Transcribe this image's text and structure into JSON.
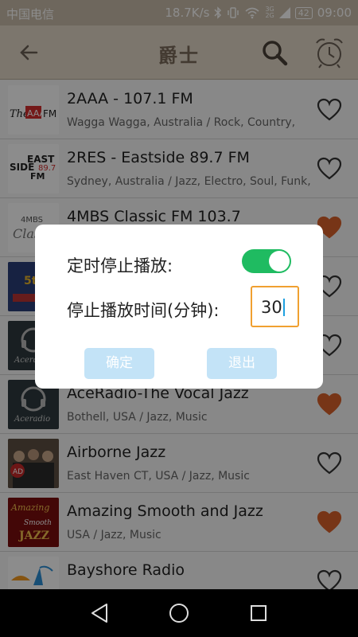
{
  "status_bar": {
    "carrier": "中国电信",
    "speed": "18.7K/s",
    "battery": "42",
    "time": "09:00",
    "net_top": "3G",
    "net_bottom": "2G"
  },
  "header": {
    "title": "爵士"
  },
  "stations": [
    {
      "name": "2AAA - 107.1 FM",
      "desc": "Wagga Wagga, Australia / Rock, Country,",
      "favorite": false,
      "logo_text": "FM"
    },
    {
      "name": "2RES - Eastside 89.7 FM",
      "desc": "Sydney, Australia / Jazz, Electro, Soul, Funk,",
      "favorite": false,
      "logo_text": "EAST SIDE 89.7 FM"
    },
    {
      "name": "4MBS Classic FM 103.7",
      "desc": "",
      "favorite": true,
      "logo_text": "4MBS"
    },
    {
      "name": "",
      "desc": "",
      "favorite": false,
      "logo_text": "5th"
    },
    {
      "name": "",
      "desc": "",
      "favorite": false,
      "logo_text": "Aceradio"
    },
    {
      "name": "AceRadio-The Vocal Jazz",
      "desc": "Bothell, USA / Jazz, Music",
      "favorite": true,
      "logo_text": "Aceradio"
    },
    {
      "name": "Airborne Jazz",
      "desc": "East Haven CT, USA / Jazz, Music",
      "favorite": false,
      "logo_text": "AD"
    },
    {
      "name": "Amazing Smooth and Jazz",
      "desc": "USA / Jazz, Music",
      "favorite": true,
      "logo_text": "Amazing Smooth JAZZ"
    },
    {
      "name": "Bayshore Radio",
      "desc": "",
      "favorite": false,
      "logo_text": ""
    }
  ],
  "dialog": {
    "timer_label": "定时停止播放:",
    "timer_enabled": true,
    "minutes_label": "停止播放时间(分钟):",
    "minutes_value": "30",
    "confirm_label": "确定",
    "exit_label": "退出"
  },
  "colors": {
    "header_bg": "#e2d7c7",
    "status_bg": "#c9bcaa",
    "toggle_on": "#1fbb61",
    "heart_filled": "#d9622b",
    "button_bg": "#c3e3f7",
    "input_border": "#f0a030"
  },
  "icons": {
    "back": "arrow-left-icon",
    "search": "search-icon",
    "alarm": "alarm-clock-icon",
    "heart": "heart-icon"
  }
}
